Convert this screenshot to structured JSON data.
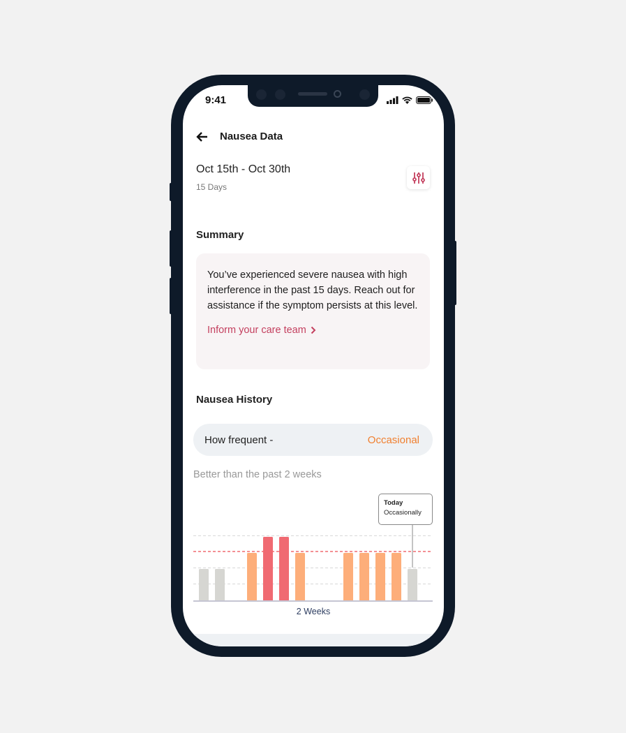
{
  "status_bar": {
    "time": "9:41"
  },
  "header": {
    "title": "Nausea Data",
    "back_icon": "arrow-left-icon"
  },
  "period": {
    "range": "Oct 15th - Oct 30th",
    "days": "15 Days",
    "filter_icon": "sliders-icon"
  },
  "summary": {
    "heading": "Summary",
    "text": "You’ve experienced severe nausea with high interference in the past 15 days. Reach out for assistance if the symptom persists at this level.",
    "link": "Inform your care team"
  },
  "history": {
    "heading": "Nausea History",
    "frequency_label": "How frequent -",
    "frequency_value": "Occasional",
    "comparison": "Better than the past 2 weeks"
  },
  "colors": {
    "accent": "#c4405f",
    "frequency": "#f08030",
    "low": "#d6d6d2",
    "medium": "#fdae7a",
    "high": "#f06a72",
    "threshold": "#e8202a"
  },
  "chart_data": {
    "type": "bar",
    "xlabel": "2 Weeks",
    "values": [
      2,
      2,
      0,
      3,
      4,
      4,
      3,
      0,
      0,
      3,
      3,
      3,
      3,
      2
    ],
    "ylim": [
      0,
      4
    ],
    "threshold": 3,
    "grid": true,
    "tooltip": {
      "title": "Today",
      "value": "Occasionally"
    }
  }
}
